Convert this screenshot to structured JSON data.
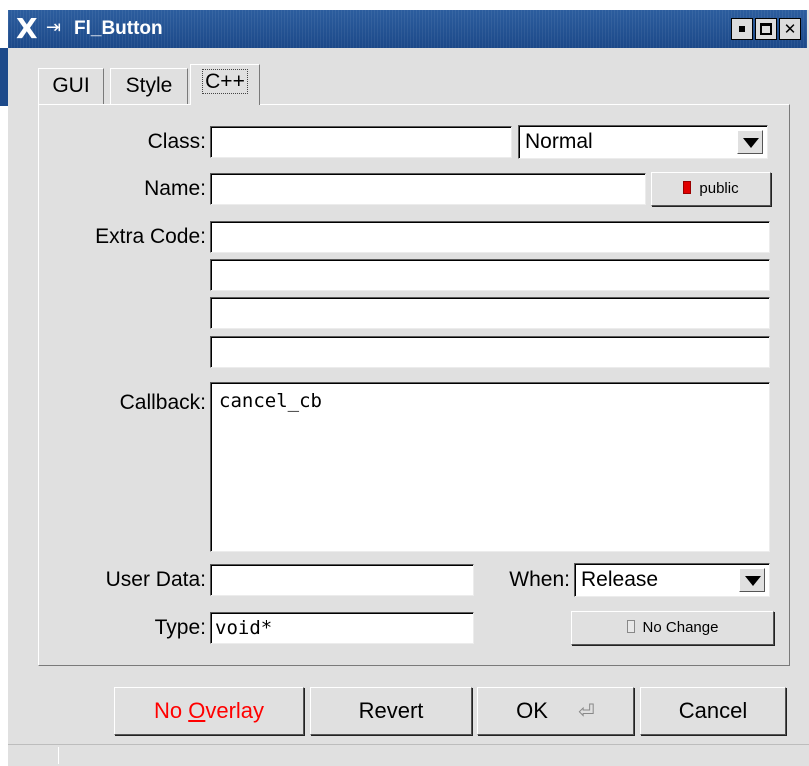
{
  "window": {
    "title": "Fl_Button",
    "controls": [
      "minimize",
      "maximize",
      "close"
    ]
  },
  "tabs": [
    {
      "label": "GUI",
      "active": false
    },
    {
      "label": "Style",
      "active": false
    },
    {
      "label": "C++",
      "active": true
    }
  ],
  "class": {
    "label": "Class:",
    "value": "",
    "type_selected": "Normal"
  },
  "name": {
    "label": "Name:",
    "value": "",
    "public_label": "public",
    "public_on": true
  },
  "extra_code": {
    "label": "Extra Code:",
    "lines": [
      "",
      "",
      "",
      ""
    ]
  },
  "callback": {
    "label": "Callback:",
    "value": "cancel_cb"
  },
  "user_data": {
    "label": "User Data:",
    "value": ""
  },
  "when": {
    "label": "When:",
    "selected": "Release"
  },
  "type": {
    "label": "Type:",
    "value": "void*"
  },
  "no_change": {
    "label": "No Change",
    "on": false
  },
  "buttons": {
    "no_overlay_prefix": "No ",
    "no_overlay_underlined": "O",
    "no_overlay_suffix": "verlay",
    "revert": "Revert",
    "ok": "OK",
    "cancel": "Cancel"
  },
  "colors": {
    "title_bar": "#1d4a8a",
    "no_overlay_text": "#ff0000",
    "public_led": "#e00000"
  }
}
